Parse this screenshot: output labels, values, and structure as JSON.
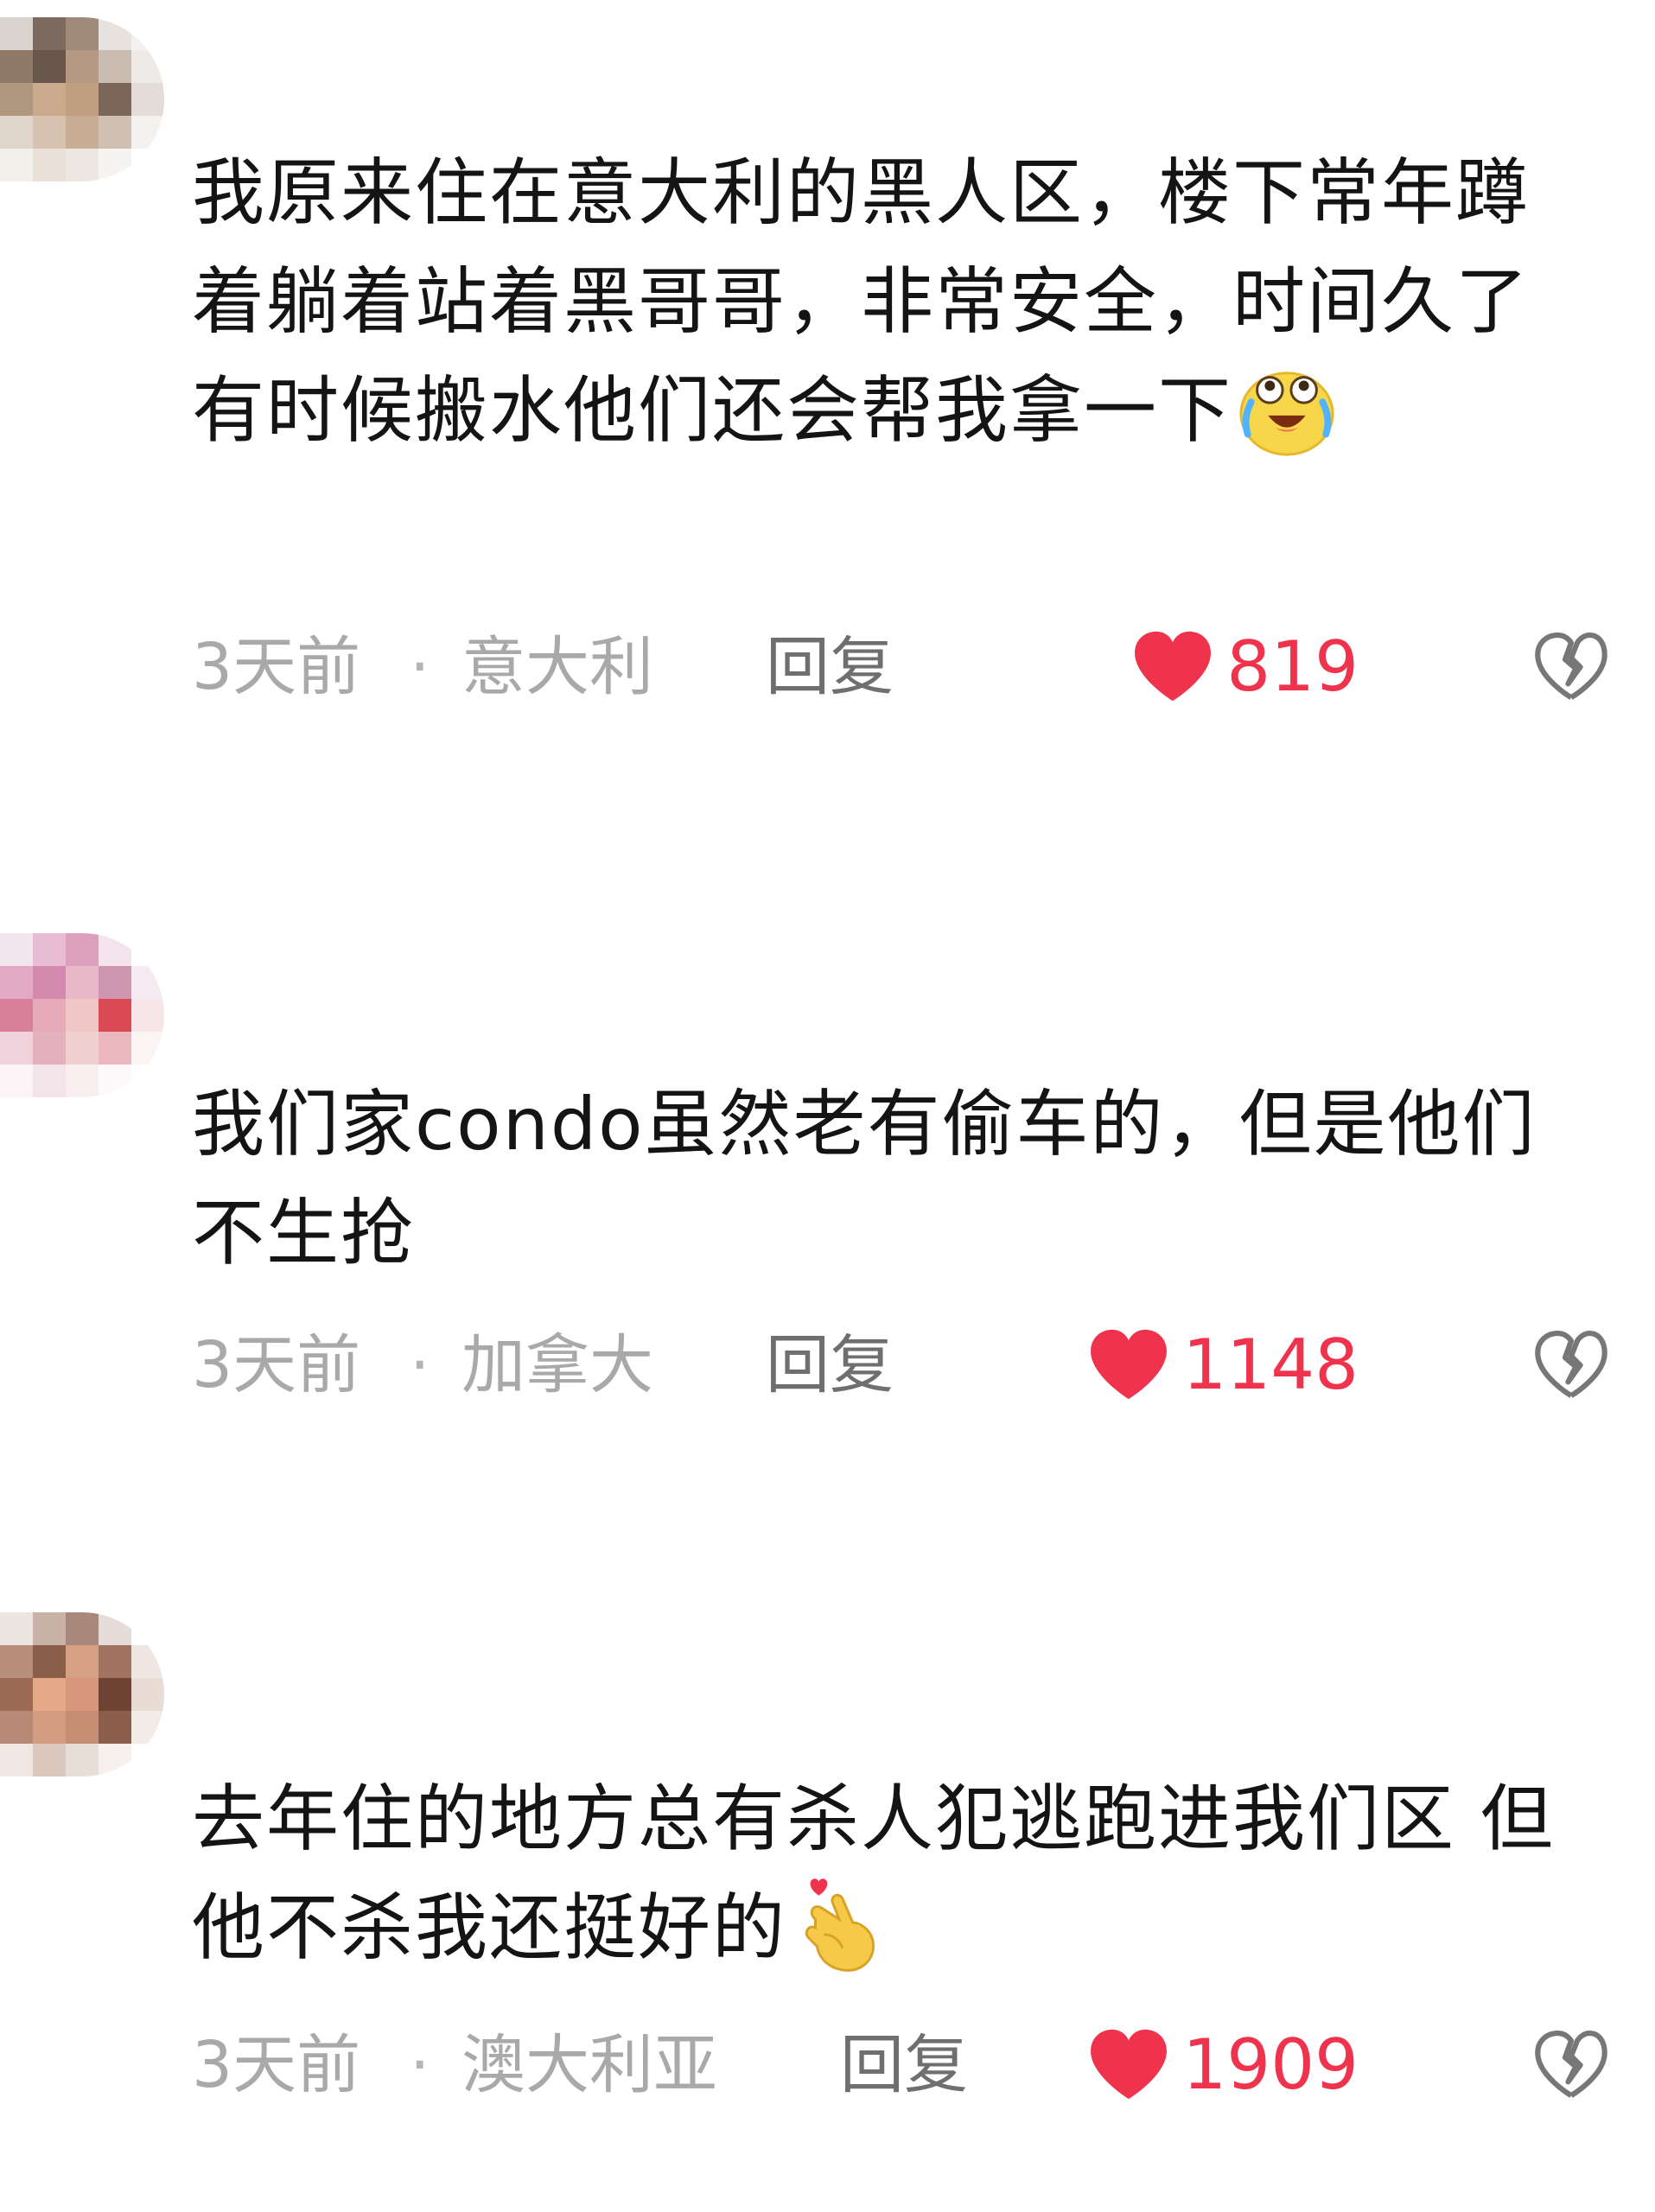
{
  "colors": {
    "accent_red": "#f0334d",
    "meta_gray": "#a9a9a9",
    "reply_gray": "#6f6f6f"
  },
  "comments": [
    {
      "text": "我原来住在意大利的黑人区，楼下常年蹲着躺着站着黑哥哥，非常安全，时间久了有时候搬水他们还会帮我拿一下",
      "emoji": "crying-laughing-face-icon",
      "time": "3天前",
      "location": "意大利",
      "reply": "回复",
      "likes": "819"
    },
    {
      "text": "我们家condo虽然老有偷车的，但是他们不生抢",
      "time": "3天前",
      "location": "加拿大",
      "reply": "回复",
      "likes": "1148"
    },
    {
      "text": "去年住的地方总有杀人犯逃跑进我们区 但他不杀我还挺好的",
      "emoji": "finger-heart-icon",
      "time": "3天前",
      "location": "澳大利亚",
      "reply": "回复",
      "likes": "1909"
    }
  ],
  "meta_separator": "·"
}
